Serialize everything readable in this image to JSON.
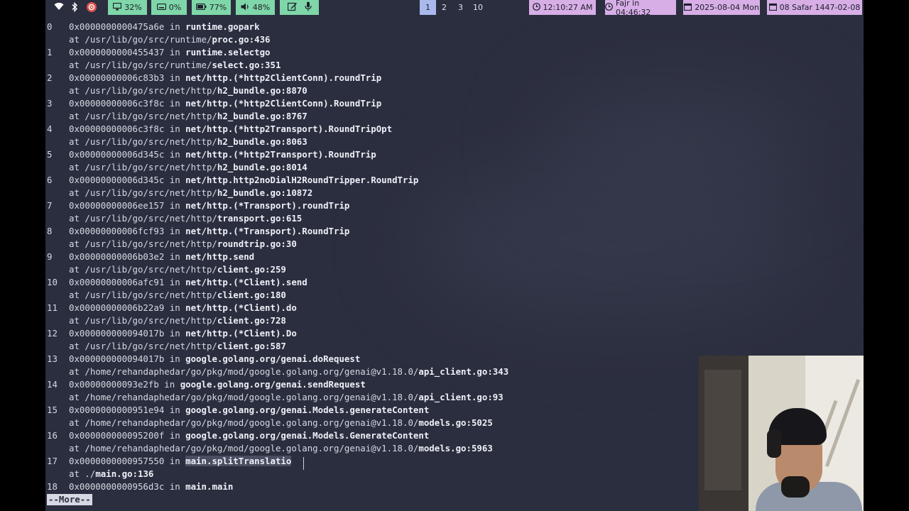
{
  "statusbar": {
    "left_icons": [
      "wifi-icon",
      "bluetooth-icon",
      "settings-icon"
    ],
    "stats": [
      {
        "icon": "monitor-icon",
        "label": "32%"
      },
      {
        "icon": "keyboard-icon",
        "label": "0%"
      },
      {
        "icon": "battery-icon",
        "label": "77%"
      },
      {
        "icon": "volume-icon",
        "label": "48%"
      }
    ],
    "tray_icons": [
      "edit-icon",
      "mic-icon"
    ],
    "workspaces": [
      "1",
      "2",
      "3",
      "10"
    ],
    "active_workspace": "1",
    "clock": {
      "icon": "clock-icon",
      "label": "12:10:27 AM"
    },
    "prayer": {
      "icon": "clock-icon",
      "label": "Fajr in 04:46:32"
    },
    "date": {
      "icon": "calendar-icon",
      "label": "2025-08-04 Mon"
    },
    "hijri": {
      "icon": "calendar-icon",
      "label": "08 Safar 1447-02-08"
    },
    "colors": {
      "green": "#7fd6a8",
      "purple": "#d7aee6",
      "active_ws": "#a9b9ec",
      "terminal_bg": "#2b2e3e"
    }
  },
  "terminal": {
    "frames": [
      {
        "num": "0",
        "addr": "0x0000000000475a6e",
        "func": "runtime.gopark",
        "path_prefix": "/usr/lib/go/src/runtime/",
        "file": "proc.go:436"
      },
      {
        "num": "1",
        "addr": "0x0000000000455437",
        "func": "runtime.selectgo",
        "path_prefix": "/usr/lib/go/src/runtime/",
        "file": "select.go:351"
      },
      {
        "num": "2",
        "addr": "0x00000000006c83b3",
        "func": "net/http.(*http2ClientConn).roundTrip",
        "path_prefix": "/usr/lib/go/src/net/http/",
        "file": "h2_bundle.go:8870"
      },
      {
        "num": "3",
        "addr": "0x00000000006c3f8c",
        "func": "net/http.(*http2ClientConn).RoundTrip",
        "path_prefix": "/usr/lib/go/src/net/http/",
        "file": "h2_bundle.go:8767"
      },
      {
        "num": "4",
        "addr": "0x00000000006c3f8c",
        "func": "net/http.(*http2Transport).RoundTripOpt",
        "path_prefix": "/usr/lib/go/src/net/http/",
        "file": "h2_bundle.go:8063"
      },
      {
        "num": "5",
        "addr": "0x00000000006d345c",
        "func": "net/http.(*http2Transport).RoundTrip",
        "path_prefix": "/usr/lib/go/src/net/http/",
        "file": "h2_bundle.go:8014"
      },
      {
        "num": "6",
        "addr": "0x00000000006d345c",
        "func": "net/http.http2noDialH2RoundTripper.RoundTrip",
        "path_prefix": "/usr/lib/go/src/net/http/",
        "file": "h2_bundle.go:10872"
      },
      {
        "num": "7",
        "addr": "0x00000000006ee157",
        "func": "net/http.(*Transport).roundTrip",
        "path_prefix": "/usr/lib/go/src/net/http/",
        "file": "transport.go:615"
      },
      {
        "num": "8",
        "addr": "0x00000000006fcf93",
        "func": "net/http.(*Transport).RoundTrip",
        "path_prefix": "/usr/lib/go/src/net/http/",
        "file": "roundtrip.go:30"
      },
      {
        "num": "9",
        "addr": "0x00000000006b03e2",
        "func": "net/http.send",
        "path_prefix": "/usr/lib/go/src/net/http/",
        "file": "client.go:259"
      },
      {
        "num": "10",
        "addr": "0x00000000006afc91",
        "func": "net/http.(*Client).send",
        "path_prefix": "/usr/lib/go/src/net/http/",
        "file": "client.go:180"
      },
      {
        "num": "11",
        "addr": "0x00000000006b22a9",
        "func": "net/http.(*Client).do",
        "path_prefix": "/usr/lib/go/src/net/http/",
        "file": "client.go:728"
      },
      {
        "num": "12",
        "addr": "0x000000000094017b",
        "func": "net/http.(*Client).Do",
        "path_prefix": "/usr/lib/go/src/net/http/",
        "file": "client.go:587"
      },
      {
        "num": "13",
        "addr": "0x000000000094017b",
        "func": "google.golang.org/genai.doRequest",
        "path_prefix": "/home/rehandaphedar/go/pkg/mod/google.golang.org/genai@v1.18.0/",
        "file": "api_client.go:343"
      },
      {
        "num": "14",
        "addr": "0x00000000093e2fb",
        "func": "google.golang.org/genai.sendRequest",
        "path_prefix": "/home/rehandaphedar/go/pkg/mod/google.golang.org/genai@v1.18.0/",
        "file": "api_client.go:93"
      },
      {
        "num": "15",
        "addr": "0x0000000000951e94",
        "func": "google.golang.org/genai.Models.generateContent",
        "path_prefix": "/home/rehandaphedar/go/pkg/mod/google.golang.org/genai@v1.18.0/",
        "file": "models.go:5025"
      },
      {
        "num": "16",
        "addr": "0x000000000095200f",
        "func": "google.golang.org/genai.Models.GenerateContent",
        "path_prefix": "/home/rehandaphedar/go/pkg/mod/google.golang.org/genai@v1.18.0/",
        "file": "models.go:5963"
      },
      {
        "num": "17",
        "addr": "0x0000000000957550",
        "func": "main.splitTranslatio",
        "path_prefix": "./",
        "file": "main.go:136",
        "highlight": true
      },
      {
        "num": "18",
        "addr": "0x0000000000956d3c",
        "func": "main.main"
      }
    ],
    "in_word": "in",
    "at_word": "at",
    "more_prompt": "--More--"
  }
}
